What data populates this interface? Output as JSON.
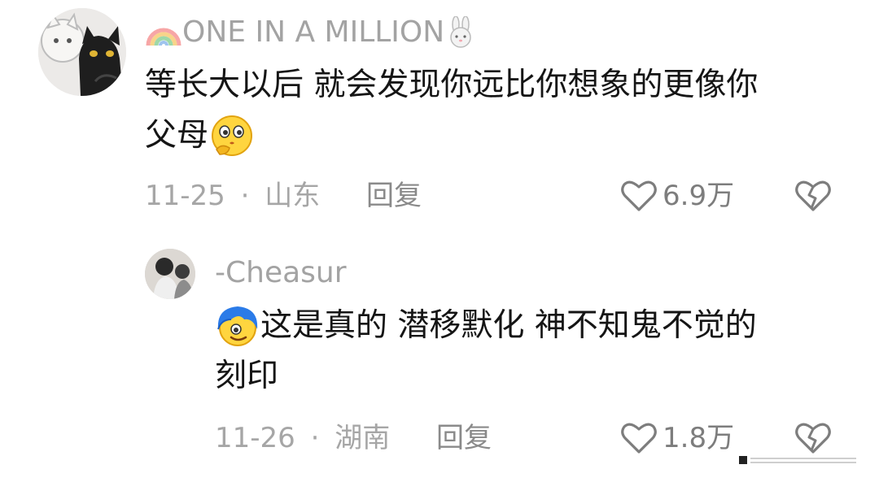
{
  "comments": [
    {
      "username": "ONE IN A MILLION",
      "username_prefix_icon": "rainbow-icon",
      "username_suffix_icon": "rabbit-icon",
      "text_line1": "等长大以后 就会发现你远比你想象的更像你",
      "text_line2": "父母",
      "emoji": "thinking-face-emoji",
      "date": "11-25",
      "separator": "·",
      "location": "山东",
      "reply_label": "回复",
      "like_count": "6.9万"
    },
    {
      "username": "-Cheasur",
      "emoji": "blue-hair-face-emoji",
      "text_line1": "这是真的 潜移默化 神不知鬼不觉的",
      "text_line2": "刻印",
      "date": "11-26",
      "separator": "·",
      "location": "湖南",
      "reply_label": "回复",
      "like_count": "1.8万"
    }
  ],
  "colors": {
    "username": "#a3a3a3",
    "text": "#151515",
    "meta": "#a6a6a6",
    "icon": "#7d7d7d"
  }
}
